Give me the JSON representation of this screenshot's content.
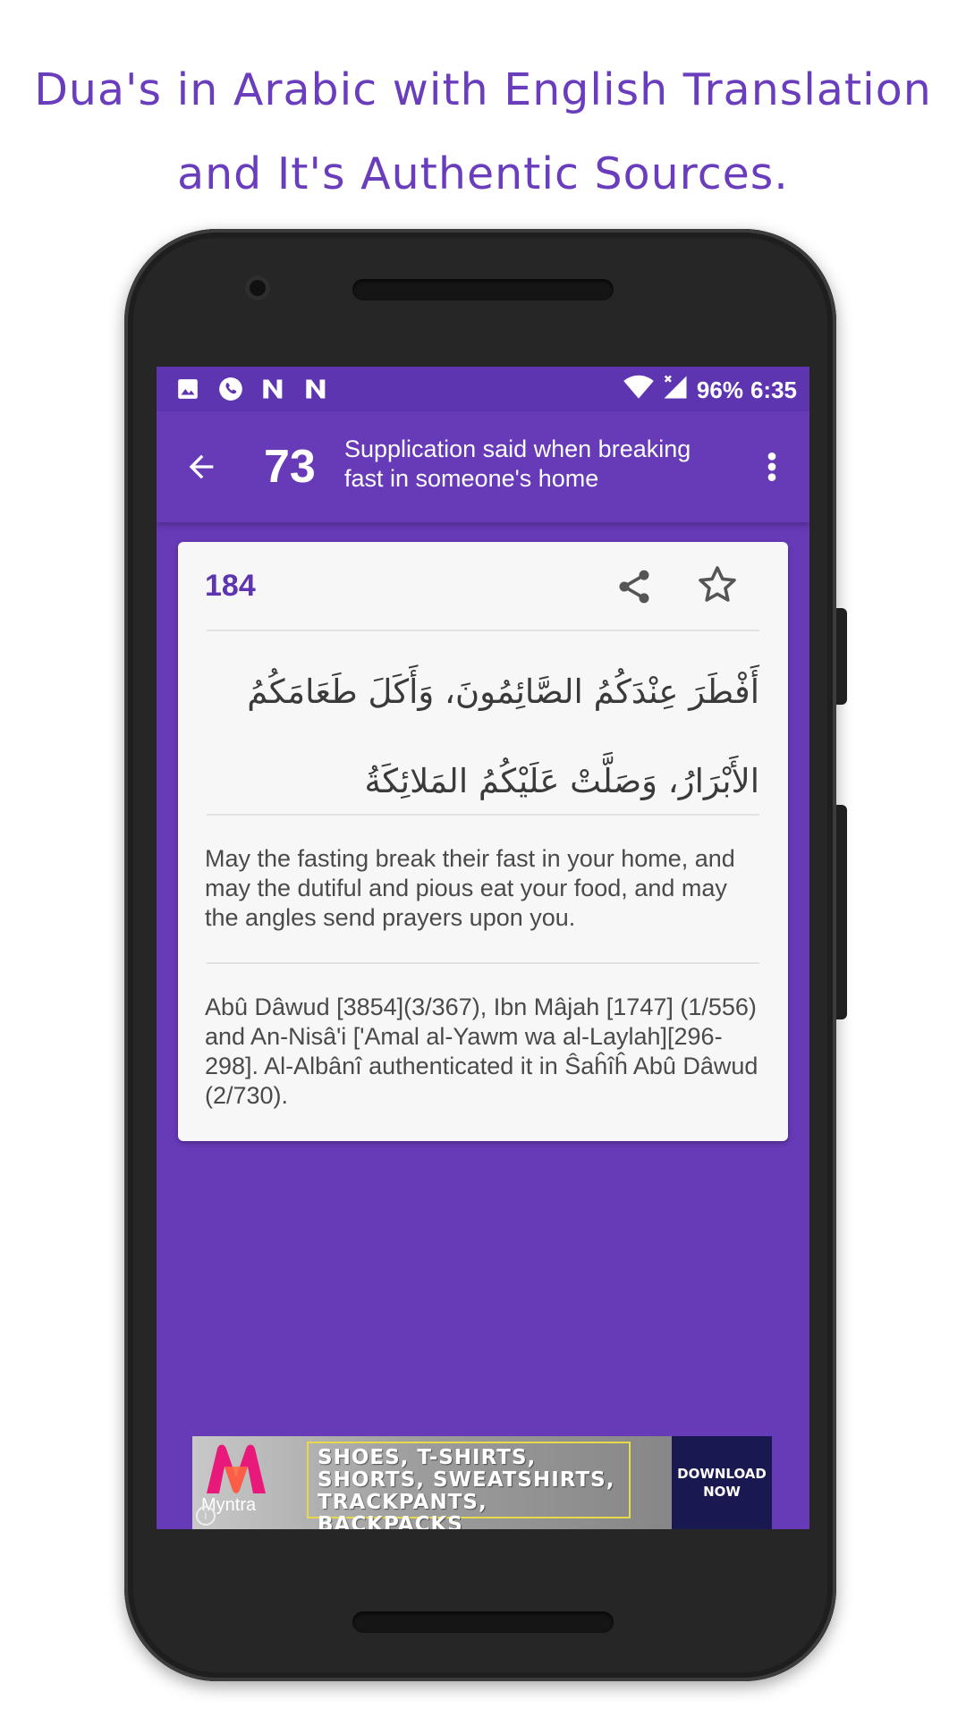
{
  "promo": {
    "line1": "Dua's in Arabic with English Translation",
    "line2": "and It's Authentic Sources."
  },
  "status_bar": {
    "battery": "96%",
    "time": "6:35",
    "left_icons": [
      "image-icon",
      "phone-icon",
      "n-icon",
      "n-icon"
    ],
    "right_icons": [
      "wifi-icon",
      "signal-icon"
    ]
  },
  "app_bar": {
    "chapter_number": "73",
    "title": "Supplication said when breaking fast in someone's home"
  },
  "card": {
    "dua_number": "184",
    "arabic": "أَفْطَرَ عِنْدَكُمُ الصَّائِمُونَ، وَأَكَلَ طَعَامَكُمُ الأَبْرَارُ، وَصَلَّتْ عَلَيْكُمُ المَلائِكَةُ",
    "translation": "May the fasting break their fast in your home, and may the dutiful and pious eat your food, and may the angles send prayers upon you.",
    "source": "Abû Dâwud [3854](3/367), Ibn Mâjah [1747] (1/556) and An-Nisâ'i ['Amal al-Yawm wa al-Laylah][296-298]. Al-Albânî authenticated it in Ŝaĥîĥ Abû Dâwud (2/730)."
  },
  "ad": {
    "brand": "Myntra",
    "text": "SHOES, T-SHIRTS, SHORTS, SWEATSHIRTS, TRACKPANTS, BACKPACKS",
    "cta": "DOWNLOAD NOW"
  },
  "colors": {
    "primary": "#673ab7",
    "primary_dark": "#5e35b1",
    "promo_text": "#6a3dbd",
    "card_bg": "#f7f7f7"
  }
}
